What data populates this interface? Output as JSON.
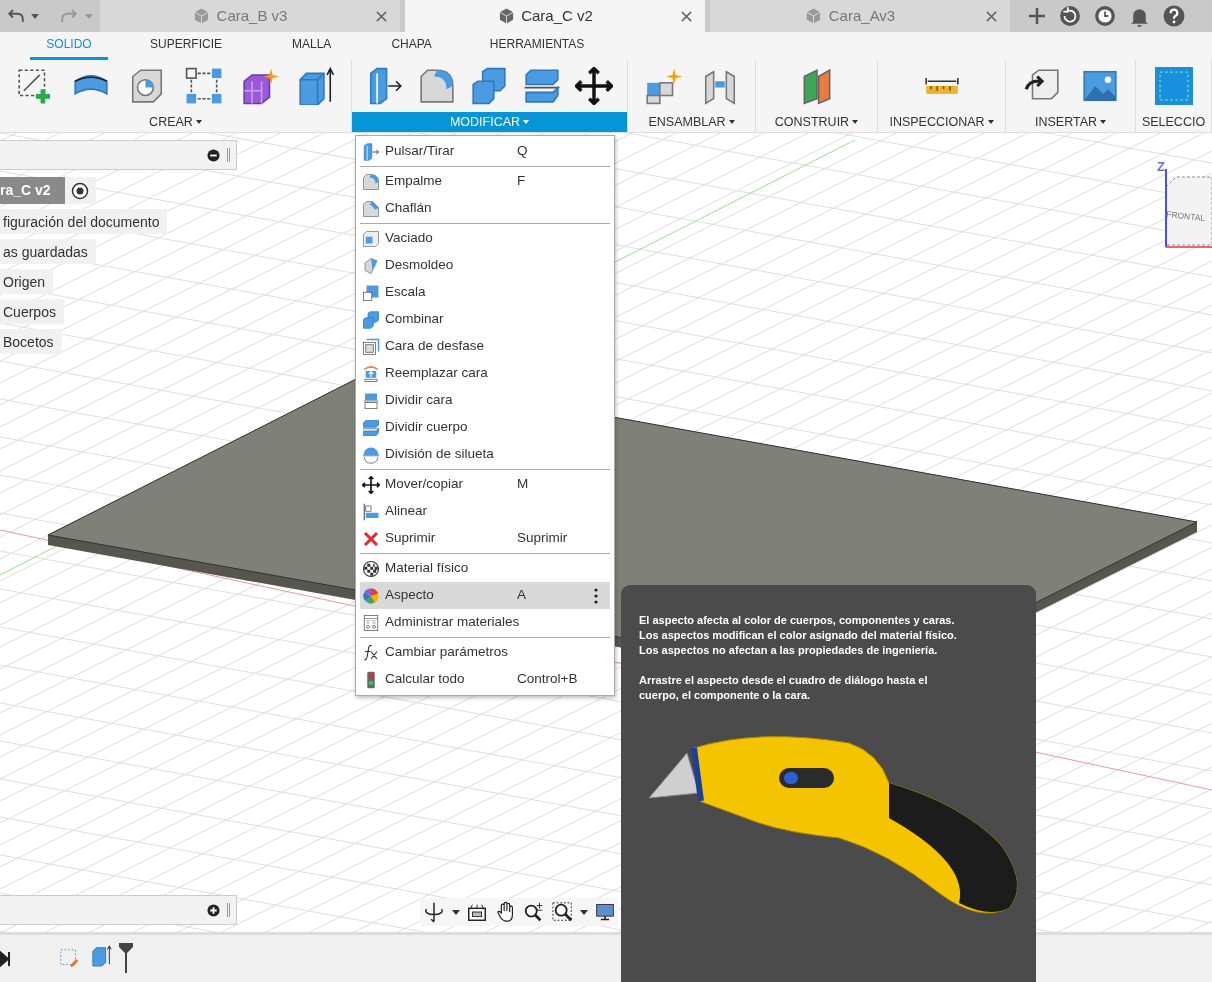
{
  "document_tabs": [
    {
      "label": "Cara_B v3",
      "selected": false
    },
    {
      "label": "Cara_C v2",
      "selected": true
    },
    {
      "label": "Cara_Av3",
      "selected": false
    }
  ],
  "ribbon_tabs": [
    {
      "label": "SOLIDO",
      "selected": true
    },
    {
      "label": "SUPERFICIE",
      "selected": false
    },
    {
      "label": "MALLA",
      "selected": false
    },
    {
      "label": "CHAPA",
      "selected": false
    },
    {
      "label": "HERRAMIENTAS",
      "selected": false
    }
  ],
  "ribbon_groups": [
    {
      "label": "CREAR",
      "selected": false,
      "tools": [
        {
          "kind": "sketch"
        },
        {
          "kind": "form"
        },
        {
          "kind": "hole"
        },
        {
          "kind": "pattern"
        },
        {
          "kind": "sparkle"
        },
        {
          "kind": "extrude"
        }
      ]
    },
    {
      "label": "MODIFICAR",
      "selected": true,
      "tools": [
        {
          "kind": "push-pull"
        },
        {
          "kind": "fillet"
        },
        {
          "kind": "combine"
        },
        {
          "kind": "split"
        },
        {
          "kind": "move"
        }
      ]
    },
    {
      "label": "ENSAMBLAR",
      "selected": false,
      "tools": [
        {
          "kind": "component"
        },
        {
          "kind": "joint"
        }
      ]
    },
    {
      "label": "CONSTRUIR",
      "selected": false,
      "tools": [
        {
          "kind": "plane"
        }
      ]
    },
    {
      "label": "INSPECCIONAR",
      "selected": false,
      "tools": [
        {
          "kind": "measure"
        }
      ]
    },
    {
      "label": "INSERTAR",
      "selected": false,
      "tools": [
        {
          "kind": "insert"
        },
        {
          "kind": "image"
        }
      ]
    },
    {
      "label": "SELECCIO",
      "selected": false,
      "tools": [
        {
          "kind": "select"
        }
      ]
    }
  ],
  "browser": {
    "items": [
      {
        "label": "ra_C v2",
        "kind": "root"
      },
      {
        "label": "figuración del documento",
        "kind": "folder"
      },
      {
        "label": "as guardadas",
        "kind": "folder"
      },
      {
        "label": "Origen",
        "kind": "folder"
      },
      {
        "label": "Cuerpos",
        "kind": "folder"
      },
      {
        "label": "Bocetos",
        "kind": "folder"
      }
    ]
  },
  "menu": {
    "sections": [
      [
        {
          "label": "Pulsar/Tirar",
          "shortcut": "Q",
          "kind": "push-pull",
          "selected": false
        }
      ],
      [
        {
          "label": "Empalme",
          "shortcut": "F",
          "kind": "fillet",
          "selected": false
        },
        {
          "label": "Chaflán",
          "kind": "chamfer",
          "selected": false
        }
      ],
      [
        {
          "label": "Vaciado",
          "kind": "shell",
          "selected": false
        },
        {
          "label": "Desmoldeo",
          "kind": "draft",
          "selected": false
        },
        {
          "label": "Escala",
          "kind": "scale",
          "selected": false
        },
        {
          "label": "Combinar",
          "kind": "combine",
          "selected": false
        },
        {
          "label": "Cara de desfase",
          "kind": "offset",
          "selected": false
        },
        {
          "label": "Reemplazar cara",
          "kind": "replace",
          "selected": false
        },
        {
          "label": "Dividir cara",
          "kind": "split-face",
          "selected": false
        },
        {
          "label": "Dividir cuerpo",
          "kind": "split",
          "selected": false
        },
        {
          "label": "División de silueta",
          "kind": "silhouette",
          "selected": false
        }
      ],
      [
        {
          "label": "Mover/copiar",
          "shortcut": "M",
          "kind": "move",
          "selected": false
        },
        {
          "label": "Alinear",
          "kind": "align",
          "selected": false
        },
        {
          "label": "Suprimir",
          "shortcut": "Suprimir",
          "kind": "delete",
          "selected": false
        }
      ],
      [
        {
          "label": "Material físico",
          "kind": "material",
          "selected": false
        },
        {
          "label": "Aspecto",
          "shortcut": "A",
          "kind": "appearance",
          "selected": true
        },
        {
          "label": "Administrar materiales",
          "kind": "manage",
          "selected": false
        }
      ],
      [
        {
          "label": "Cambiar parámetros",
          "kind": "fx",
          "selected": false
        },
        {
          "label": "Calcular todo",
          "shortcut": "Control+B",
          "kind": "compute",
          "selected": false
        }
      ]
    ]
  },
  "tooltip": {
    "paragraphs": [
      [
        "El aspecto afecta al color de cuerpos, componentes y caras.",
        "Los aspectos modifican el color asignado del material físico.",
        "Los aspectos no afectan a las propiedades de ingeniería."
      ],
      [
        "Arrastre el aspecto desde el cuadro de diálogo hasta el",
        "cuerpo, el componente o la cara."
      ]
    ]
  },
  "viewcube": {
    "axis_label": "Z",
    "face_label": "FRONTAL"
  }
}
